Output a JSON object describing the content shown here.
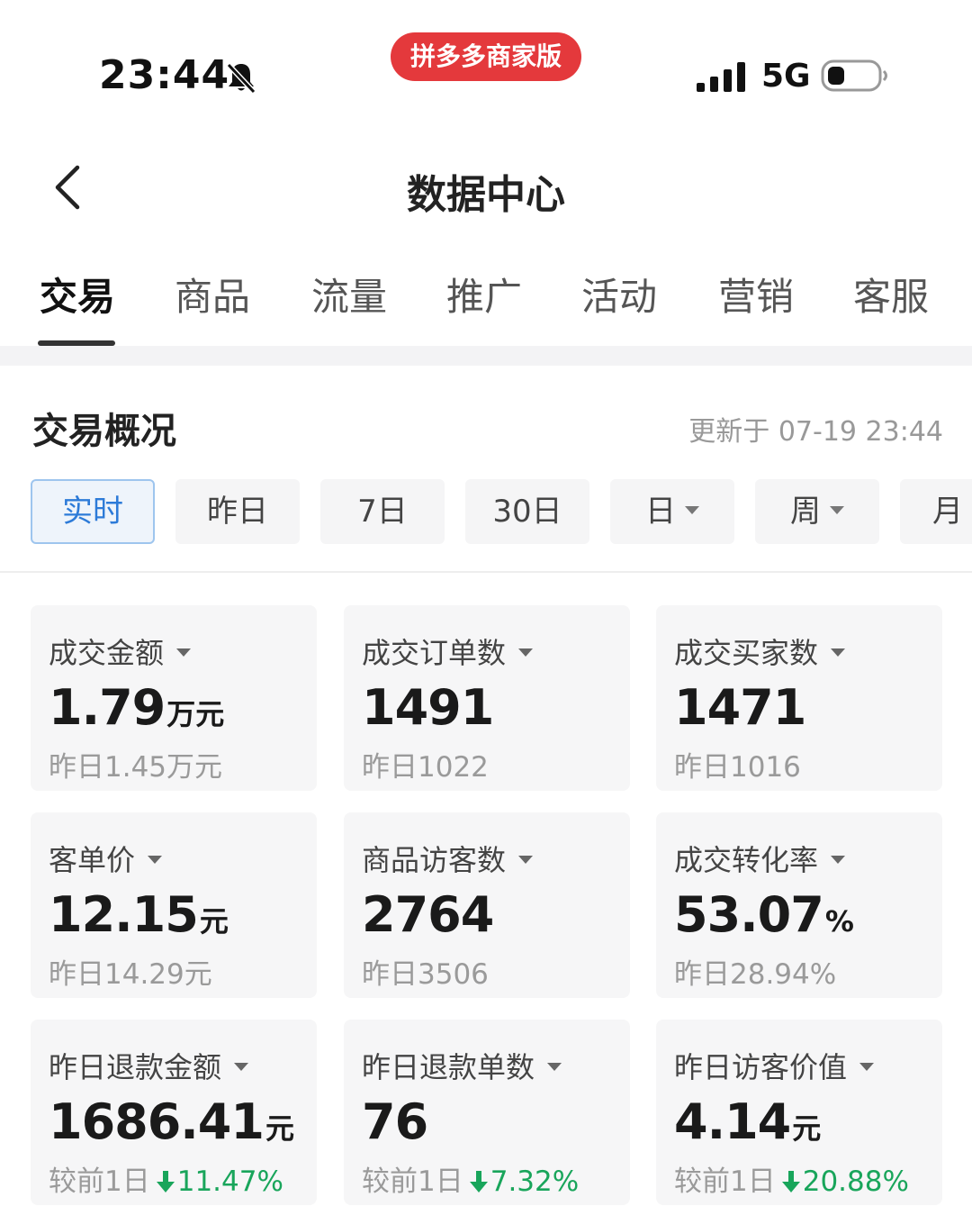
{
  "status_bar": {
    "time": "23:44",
    "app_badge": "拼多多商家版",
    "network": "5G"
  },
  "nav": {
    "title": "数据中心"
  },
  "tabs": [
    {
      "label": "交易",
      "active": true
    },
    {
      "label": "商品",
      "active": false
    },
    {
      "label": "流量",
      "active": false
    },
    {
      "label": "推广",
      "active": false
    },
    {
      "label": "活动",
      "active": false
    },
    {
      "label": "营销",
      "active": false
    },
    {
      "label": "客服",
      "active": false
    }
  ],
  "overview": {
    "title": "交易概况",
    "update_time": "更新于 07-19 23:44"
  },
  "periods": [
    {
      "label": "实时",
      "active": true
    },
    {
      "label": "昨日"
    },
    {
      "label": "7日"
    },
    {
      "label": "30日"
    },
    {
      "label": "日"
    },
    {
      "label": "周"
    },
    {
      "label": "月"
    }
  ],
  "metrics": [
    {
      "label": "成交金额",
      "value": "1.79",
      "unit": "万元",
      "sub": "昨日1.45万元"
    },
    {
      "label": "成交订单数",
      "value": "1491",
      "unit": "",
      "sub": "昨日1022"
    },
    {
      "label": "成交买家数",
      "value": "1471",
      "unit": "",
      "sub": "昨日1016"
    },
    {
      "label": "客单价",
      "value": "12.15",
      "unit": "元",
      "sub": "昨日14.29元"
    },
    {
      "label": "商品访客数",
      "value": "2764",
      "unit": "",
      "sub": "昨日3506"
    },
    {
      "label": "成交转化率",
      "value": "53.07",
      "unit": "%",
      "sub": "昨日28.94%"
    },
    {
      "label": "昨日退款金额",
      "value": "1686.41",
      "unit": "元",
      "sub_prefix": "较前1日",
      "delta": "11.47%"
    },
    {
      "label": "昨日退款单数",
      "value": "76",
      "unit": "",
      "sub_prefix": "较前1日",
      "delta": "7.32%"
    },
    {
      "label": "昨日访客价值",
      "value": "4.14",
      "unit": "元",
      "sub_prefix": "较前1日",
      "delta": "20.88%"
    }
  ],
  "colors": {
    "brand_red": "#e4393c",
    "active_blue": "#2d7bd8",
    "decrease_green": "#19a55b"
  }
}
